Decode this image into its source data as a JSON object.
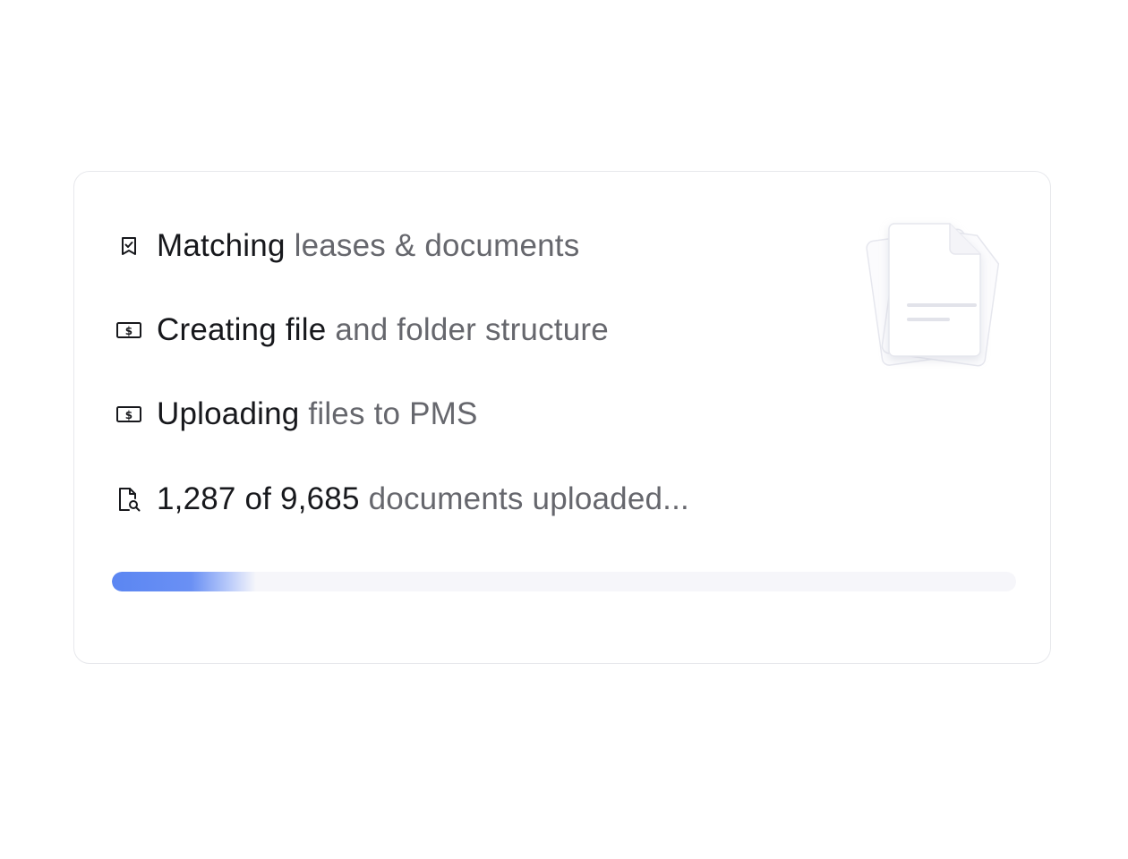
{
  "colors": {
    "text_strong": "#17181c",
    "text_muted": "#66676d",
    "card_border": "#e7e8ec",
    "progress_track": "#f6f6fa",
    "progress_accent": "#5b86f2"
  },
  "steps": [
    {
      "icon": "bookmark-check-icon",
      "strong": "Matching",
      "rest": "leases & documents"
    },
    {
      "icon": "dollar-bill-icon",
      "strong": "Creating file",
      "rest": "and folder structure"
    },
    {
      "icon": "dollar-bill-icon",
      "strong": "Uploading",
      "rest": "files to PMS"
    },
    {
      "icon": "document-search-icon",
      "strong": "1,287 of 9,685",
      "rest": "documents uploaded..."
    }
  ],
  "progress": {
    "uploaded": 1287,
    "total": 9685
  },
  "illustration": {
    "icon": "document-stack-icon"
  }
}
